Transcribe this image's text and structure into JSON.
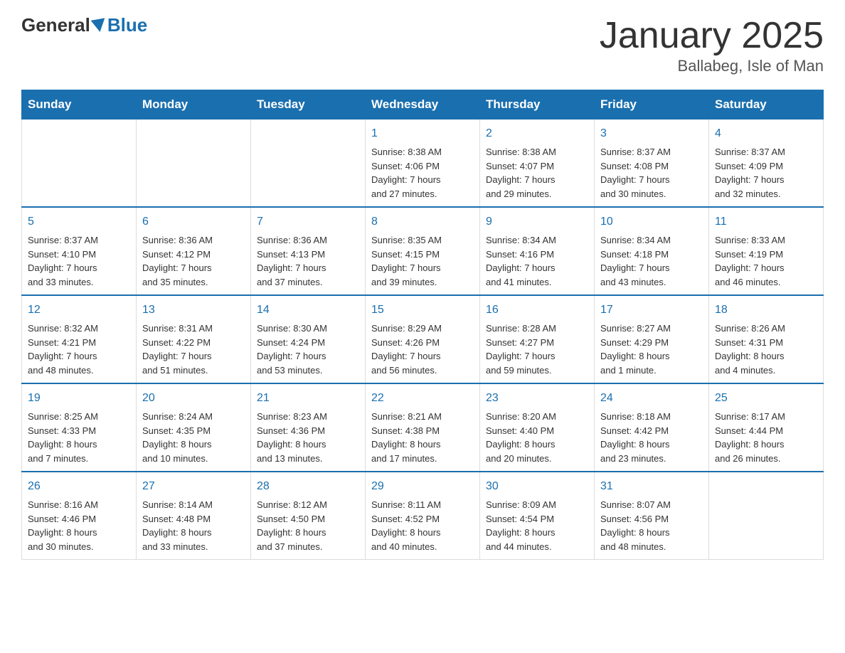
{
  "header": {
    "logo": {
      "text_general": "General",
      "text_blue": "Blue"
    },
    "title": "January 2025",
    "location": "Ballabeg, Isle of Man"
  },
  "weekdays": [
    "Sunday",
    "Monday",
    "Tuesday",
    "Wednesday",
    "Thursday",
    "Friday",
    "Saturday"
  ],
  "weeks": [
    [
      {
        "day": "",
        "info": ""
      },
      {
        "day": "",
        "info": ""
      },
      {
        "day": "",
        "info": ""
      },
      {
        "day": "1",
        "info": "Sunrise: 8:38 AM\nSunset: 4:06 PM\nDaylight: 7 hours\nand 27 minutes."
      },
      {
        "day": "2",
        "info": "Sunrise: 8:38 AM\nSunset: 4:07 PM\nDaylight: 7 hours\nand 29 minutes."
      },
      {
        "day": "3",
        "info": "Sunrise: 8:37 AM\nSunset: 4:08 PM\nDaylight: 7 hours\nand 30 minutes."
      },
      {
        "day": "4",
        "info": "Sunrise: 8:37 AM\nSunset: 4:09 PM\nDaylight: 7 hours\nand 32 minutes."
      }
    ],
    [
      {
        "day": "5",
        "info": "Sunrise: 8:37 AM\nSunset: 4:10 PM\nDaylight: 7 hours\nand 33 minutes."
      },
      {
        "day": "6",
        "info": "Sunrise: 8:36 AM\nSunset: 4:12 PM\nDaylight: 7 hours\nand 35 minutes."
      },
      {
        "day": "7",
        "info": "Sunrise: 8:36 AM\nSunset: 4:13 PM\nDaylight: 7 hours\nand 37 minutes."
      },
      {
        "day": "8",
        "info": "Sunrise: 8:35 AM\nSunset: 4:15 PM\nDaylight: 7 hours\nand 39 minutes."
      },
      {
        "day": "9",
        "info": "Sunrise: 8:34 AM\nSunset: 4:16 PM\nDaylight: 7 hours\nand 41 minutes."
      },
      {
        "day": "10",
        "info": "Sunrise: 8:34 AM\nSunset: 4:18 PM\nDaylight: 7 hours\nand 43 minutes."
      },
      {
        "day": "11",
        "info": "Sunrise: 8:33 AM\nSunset: 4:19 PM\nDaylight: 7 hours\nand 46 minutes."
      }
    ],
    [
      {
        "day": "12",
        "info": "Sunrise: 8:32 AM\nSunset: 4:21 PM\nDaylight: 7 hours\nand 48 minutes."
      },
      {
        "day": "13",
        "info": "Sunrise: 8:31 AM\nSunset: 4:22 PM\nDaylight: 7 hours\nand 51 minutes."
      },
      {
        "day": "14",
        "info": "Sunrise: 8:30 AM\nSunset: 4:24 PM\nDaylight: 7 hours\nand 53 minutes."
      },
      {
        "day": "15",
        "info": "Sunrise: 8:29 AM\nSunset: 4:26 PM\nDaylight: 7 hours\nand 56 minutes."
      },
      {
        "day": "16",
        "info": "Sunrise: 8:28 AM\nSunset: 4:27 PM\nDaylight: 7 hours\nand 59 minutes."
      },
      {
        "day": "17",
        "info": "Sunrise: 8:27 AM\nSunset: 4:29 PM\nDaylight: 8 hours\nand 1 minute."
      },
      {
        "day": "18",
        "info": "Sunrise: 8:26 AM\nSunset: 4:31 PM\nDaylight: 8 hours\nand 4 minutes."
      }
    ],
    [
      {
        "day": "19",
        "info": "Sunrise: 8:25 AM\nSunset: 4:33 PM\nDaylight: 8 hours\nand 7 minutes."
      },
      {
        "day": "20",
        "info": "Sunrise: 8:24 AM\nSunset: 4:35 PM\nDaylight: 8 hours\nand 10 minutes."
      },
      {
        "day": "21",
        "info": "Sunrise: 8:23 AM\nSunset: 4:36 PM\nDaylight: 8 hours\nand 13 minutes."
      },
      {
        "day": "22",
        "info": "Sunrise: 8:21 AM\nSunset: 4:38 PM\nDaylight: 8 hours\nand 17 minutes."
      },
      {
        "day": "23",
        "info": "Sunrise: 8:20 AM\nSunset: 4:40 PM\nDaylight: 8 hours\nand 20 minutes."
      },
      {
        "day": "24",
        "info": "Sunrise: 8:18 AM\nSunset: 4:42 PM\nDaylight: 8 hours\nand 23 minutes."
      },
      {
        "day": "25",
        "info": "Sunrise: 8:17 AM\nSunset: 4:44 PM\nDaylight: 8 hours\nand 26 minutes."
      }
    ],
    [
      {
        "day": "26",
        "info": "Sunrise: 8:16 AM\nSunset: 4:46 PM\nDaylight: 8 hours\nand 30 minutes."
      },
      {
        "day": "27",
        "info": "Sunrise: 8:14 AM\nSunset: 4:48 PM\nDaylight: 8 hours\nand 33 minutes."
      },
      {
        "day": "28",
        "info": "Sunrise: 8:12 AM\nSunset: 4:50 PM\nDaylight: 8 hours\nand 37 minutes."
      },
      {
        "day": "29",
        "info": "Sunrise: 8:11 AM\nSunset: 4:52 PM\nDaylight: 8 hours\nand 40 minutes."
      },
      {
        "day": "30",
        "info": "Sunrise: 8:09 AM\nSunset: 4:54 PM\nDaylight: 8 hours\nand 44 minutes."
      },
      {
        "day": "31",
        "info": "Sunrise: 8:07 AM\nSunset: 4:56 PM\nDaylight: 8 hours\nand 48 minutes."
      },
      {
        "day": "",
        "info": ""
      }
    ]
  ]
}
